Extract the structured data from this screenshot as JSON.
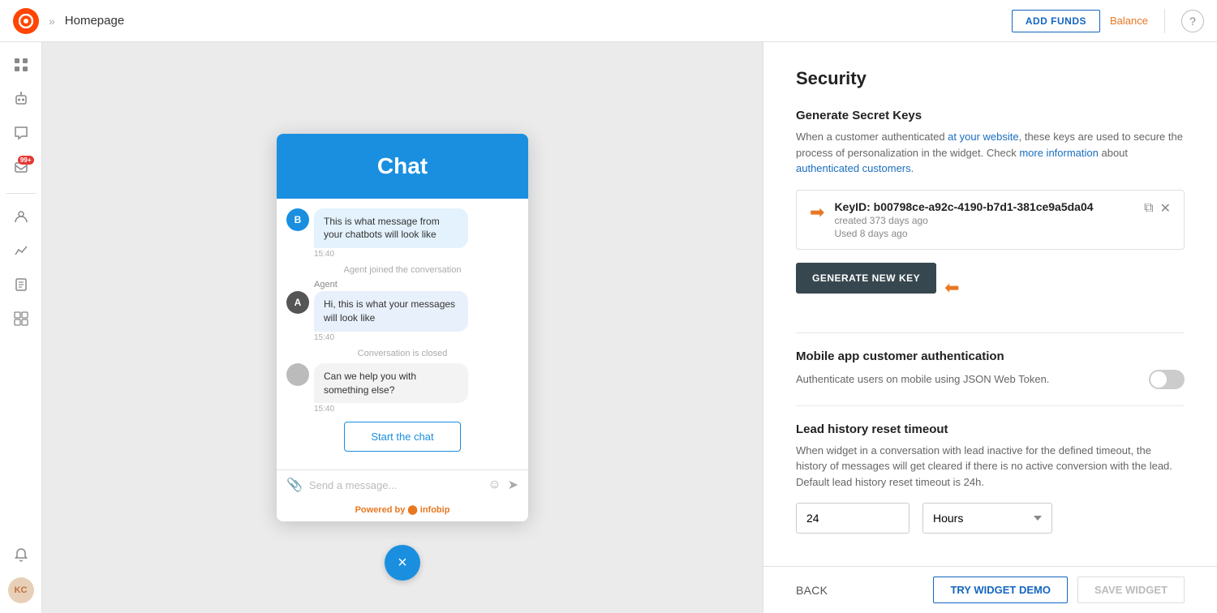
{
  "topbar": {
    "logo_text": "●",
    "chevron": "»",
    "title": "Homepage",
    "add_funds_label": "ADD FUNDS",
    "balance_label": "Balance",
    "help_icon": "?"
  },
  "sidebar": {
    "items": [
      {
        "name": "dashboard",
        "icon": "⊞",
        "active": false
      },
      {
        "name": "bot",
        "icon": "🤖",
        "active": false
      },
      {
        "name": "chat",
        "icon": "💬",
        "active": false
      },
      {
        "name": "inbox",
        "icon": "📥",
        "badge": "99+",
        "active": false
      },
      {
        "name": "agents",
        "icon": "👥",
        "active": false
      },
      {
        "name": "analytics",
        "icon": "📈",
        "active": false
      },
      {
        "name": "reports",
        "icon": "📋",
        "active": false
      },
      {
        "name": "grid",
        "icon": "⊟",
        "active": false
      }
    ],
    "avatar": "KC"
  },
  "chat_widget": {
    "header_title": "Chat",
    "messages": [
      {
        "type": "bot",
        "avatar": "B",
        "text": "This is what message from your chatbots will look like",
        "time": "15:40"
      },
      {
        "type": "system",
        "text": "Agent joined the conversation"
      },
      {
        "type": "agent",
        "label": "Agent",
        "avatar": "A",
        "text": "Hi, this is what your messages will look like",
        "time": "15:40"
      },
      {
        "type": "system",
        "text": "Conversation is closed"
      },
      {
        "type": "bot_grey",
        "avatar": "",
        "text": "Can we help you with something else?",
        "time": "15:40"
      }
    ],
    "start_chat_label": "Start the chat",
    "input_placeholder": "Send a message...",
    "powered_by": "Powered by",
    "powered_brand": "infobip",
    "close_icon": "×"
  },
  "security": {
    "title": "Security",
    "generate_keys_title": "Generate Secret Keys",
    "generate_keys_desc_1": "When a customer authenticated",
    "generate_keys_link1": "at your website",
    "generate_keys_desc_2": ", these keys are used to secure the process of personalization in the widget. Check",
    "generate_keys_link2": "more information",
    "generate_keys_desc_3": "about",
    "generate_keys_link3": "authenticated customers",
    "generate_keys_desc_4": ".",
    "key_id": "KeyID: b00798ce-a92c-4190-b7d1-381ce9a5da04",
    "key_created": "created 373 days ago",
    "key_used": "Used 8 days ago",
    "generate_btn_label": "GENERATE NEW KEY",
    "mobile_auth_title": "Mobile app customer authentication",
    "mobile_auth_desc": "Authenticate users on mobile using JSON Web Token.",
    "lead_history_title": "Lead history reset timeout",
    "lead_history_desc": "When widget in a conversation with lead inactive for the defined timeout, the history of messages will get cleared if there is no active conversion with the lead. Default lead history reset timeout is 24h.",
    "timeout_value": "24",
    "timeout_unit": "Hours"
  },
  "bottom_bar": {
    "back_label": "BACK",
    "try_demo_label": "TRY WIDGET DEMO",
    "save_label": "SAVE WIDGET"
  }
}
